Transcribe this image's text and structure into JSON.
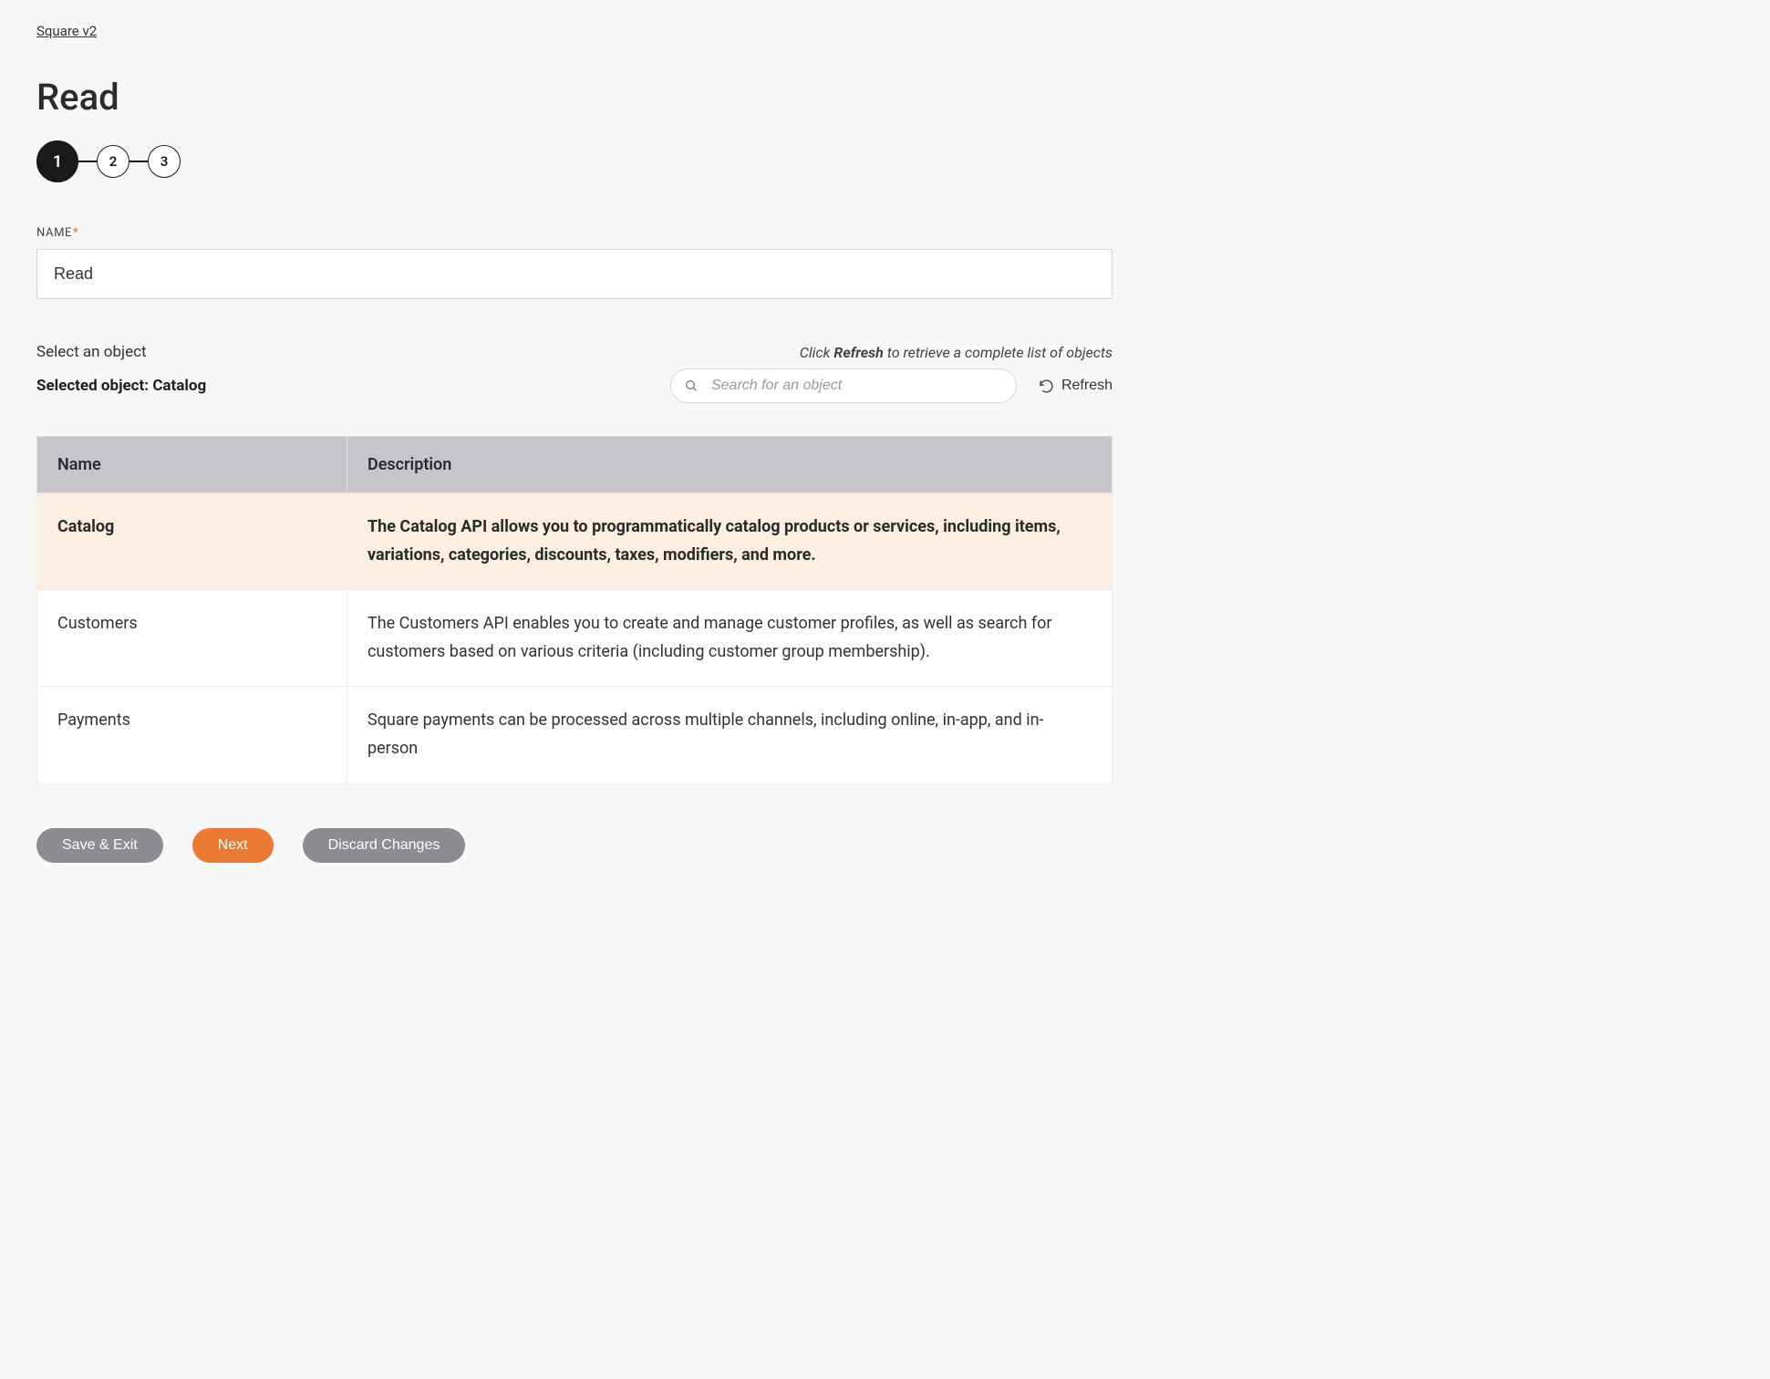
{
  "breadcrumb": {
    "label": "Square v2"
  },
  "page": {
    "title": "Read"
  },
  "stepper": {
    "steps": [
      "1",
      "2",
      "3"
    ],
    "active_index": 0
  },
  "name_field": {
    "label": "NAME",
    "required_marker": "*",
    "value": "Read"
  },
  "select_section": {
    "label": "Select an object",
    "selected_prefix": "Selected object: ",
    "selected_value": "Catalog",
    "hint_prefix": "Click ",
    "hint_bold": "Refresh",
    "hint_suffix": " to retrieve a complete list of objects"
  },
  "search": {
    "placeholder": "Search for an object"
  },
  "refresh": {
    "label": "Refresh"
  },
  "table": {
    "columns": {
      "name": "Name",
      "description": "Description"
    },
    "selected_index": 0,
    "rows": [
      {
        "name": "Catalog",
        "description": "The Catalog API allows you to programmatically catalog products or services, including items, variations, categories, discounts, taxes, modifiers, and more."
      },
      {
        "name": "Customers",
        "description": "The Customers API enables you to create and manage customer profiles, as well as search for customers based on various criteria (including customer group membership)."
      },
      {
        "name": "Payments",
        "description": "Square payments can be processed across multiple channels, including online, in-app, and in-person"
      }
    ]
  },
  "buttons": {
    "save_exit": "Save & Exit",
    "next": "Next",
    "discard": "Discard Changes"
  }
}
